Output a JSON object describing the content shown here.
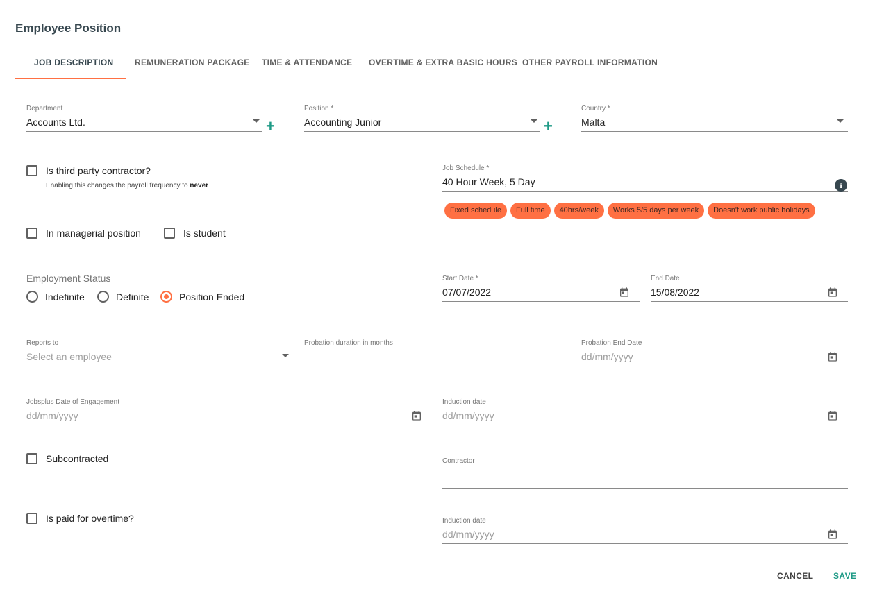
{
  "dialog": {
    "title": "Employee Position"
  },
  "tabs": [
    {
      "label": "JOB DESCRIPTION"
    },
    {
      "label": "REMUNERATION PACKAGE"
    },
    {
      "label": "TIME & ATTENDANCE"
    },
    {
      "label": "OVERTIME & EXTRA BASIC HOURS"
    },
    {
      "label": "OTHER PAYROLL INFORMATION"
    }
  ],
  "department": {
    "label": "Department",
    "value": "Accounts Ltd."
  },
  "position": {
    "label": "Position *",
    "value": "Accounting Junior"
  },
  "country": {
    "label": "Country *",
    "value": "Malta"
  },
  "third_party": {
    "label": "Is third party contractor?",
    "hint_prefix": "Enabling this changes the payroll frequency to",
    "hint_strong": "never"
  },
  "job_schedule": {
    "label": "Job Schedule *",
    "value": "40 Hour Week, 5 Day",
    "chips": [
      "Fixed schedule",
      "Full time",
      "40hrs/week",
      "Works 5/5 days per week",
      "Doesn't work public holidays"
    ]
  },
  "managerial": {
    "label": "In managerial position"
  },
  "student": {
    "label": "Is student"
  },
  "employment_status": {
    "label": "Employment Status",
    "options": [
      "Indefinite",
      "Definite",
      "Position Ended"
    ],
    "selected": "Position Ended"
  },
  "start_date": {
    "label": "Start Date *",
    "value": "07/07/2022"
  },
  "end_date": {
    "label": "End Date",
    "value": "15/08/2022"
  },
  "reports_to": {
    "label": "Reports to",
    "placeholder": "Select an employee"
  },
  "probation_duration": {
    "label": "Probation duration in months",
    "value": ""
  },
  "probation_end": {
    "label": "Probation End Date",
    "placeholder": "dd/mm/yyyy"
  },
  "jobsplus_date": {
    "label": "Jobsplus Date of Engagement",
    "placeholder": "dd/mm/yyyy"
  },
  "induction_date": {
    "label": "Induction date",
    "placeholder": "dd/mm/yyyy"
  },
  "subcontracted": {
    "label": "Subcontracted"
  },
  "contractor": {
    "label": "Contractor",
    "value": ""
  },
  "paid_overtime": {
    "label": "Is paid for overtime?"
  },
  "induction_date_2": {
    "label": "Induction date",
    "placeholder": "dd/mm/yyyy"
  },
  "actions": {
    "cancel": "CANCEL",
    "save": "SAVE"
  },
  "colors": {
    "accent": "#ff7043",
    "primary": "#1e9a86",
    "header": "#37474f"
  }
}
